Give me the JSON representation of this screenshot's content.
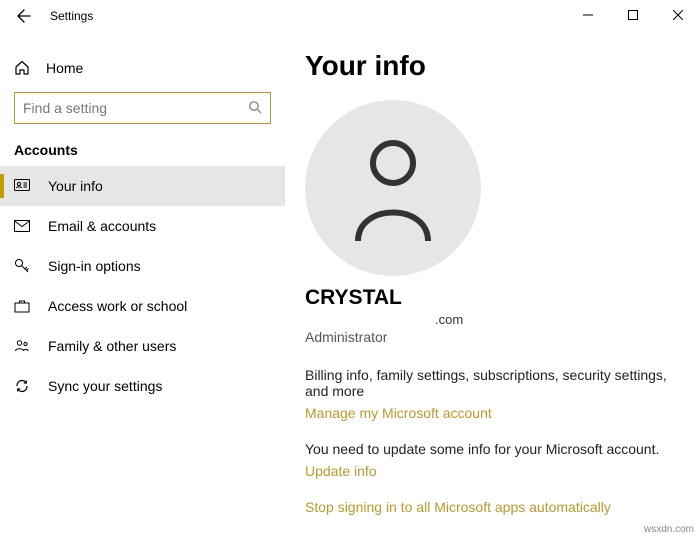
{
  "titlebar": {
    "app_title": "Settings"
  },
  "sidebar": {
    "home_label": "Home",
    "search_placeholder": "Find a setting",
    "section_label": "Accounts",
    "items": [
      {
        "label": "Your info"
      },
      {
        "label": "Email & accounts"
      },
      {
        "label": "Sign-in options"
      },
      {
        "label": "Access work or school"
      },
      {
        "label": "Family & other users"
      },
      {
        "label": "Sync your settings"
      }
    ]
  },
  "content": {
    "page_title": "Your info",
    "user_name": "CRYSTAL",
    "user_email": ".com",
    "user_role": "Administrator",
    "billing_desc": "Billing info, family settings, subscriptions, security settings, and more",
    "manage_link": "Manage my Microsoft account",
    "update_desc": "You need to update some info for your Microsoft account.",
    "update_link": "Update info",
    "stop_signing_link": "Stop signing in to all Microsoft apps automatically"
  },
  "watermark": "wsxdn.com"
}
